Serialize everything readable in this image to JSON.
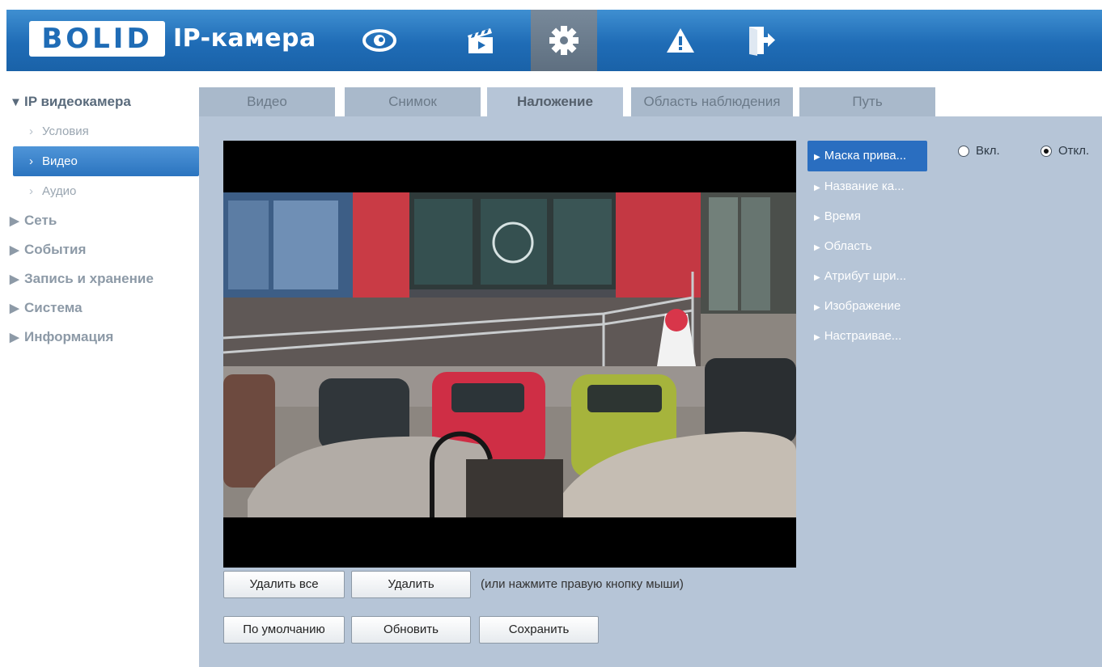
{
  "header": {
    "logo_text": "BOLID",
    "title": "IP-камера",
    "nav_icons": [
      "eye-icon",
      "clapperboard-icon",
      "gear-icon",
      "warning-icon",
      "logout-icon"
    ],
    "active_nav": "gear-icon",
    "accent_color": "#1f6cb6"
  },
  "sidebar": {
    "root": "IP видеокамера",
    "sub_items": [
      "Условия",
      "Видео",
      "Аудио"
    ],
    "active_sub": "Видео",
    "sections": [
      "Сеть",
      "События",
      "Запись и хранение",
      "Система",
      "Информация"
    ]
  },
  "tabs": [
    "Видео",
    "Снимок",
    "Наложение",
    "Область наблюдения",
    "Путь"
  ],
  "active_tab": "Наложение",
  "overlay_menu": [
    "Маска прива...",
    "Название ка...",
    "Время",
    "Область",
    "Атрибут шри...",
    "Изображение",
    "Настраивае..."
  ],
  "active_overlay": "Маска прива...",
  "privacy_mask": {
    "on_label": "Вкл.",
    "off_label": "Откл.",
    "selected": "off"
  },
  "buttons": {
    "delete_all": "Удалить все",
    "delete": "Удалить",
    "hint": "(или нажмите правую кнопку мыши)",
    "default": "По умолчанию",
    "refresh": "Обновить",
    "save": "Сохранить"
  }
}
